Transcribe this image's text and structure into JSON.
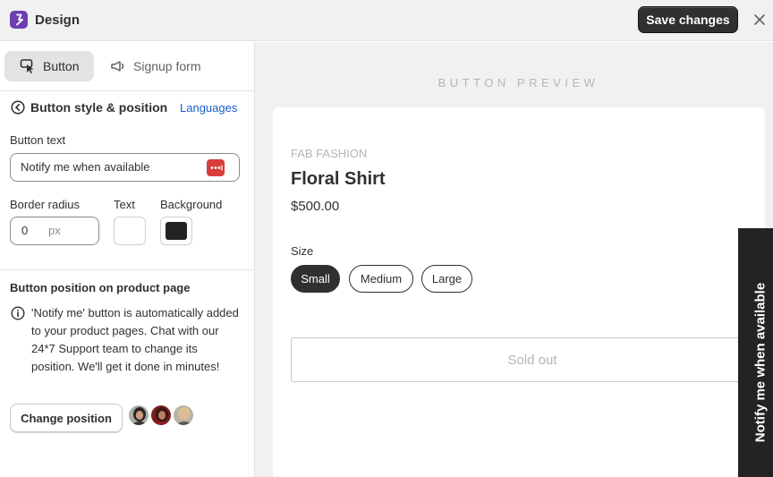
{
  "app": {
    "title": "Design",
    "save_label": "Save changes"
  },
  "tabs": [
    {
      "label": "Button",
      "icon": "cursor-click-icon"
    },
    {
      "label": "Signup form",
      "icon": "megaphone-icon"
    }
  ],
  "section": {
    "title": "Button style & position",
    "languages_link": "Languages"
  },
  "button_text": {
    "label": "Button text",
    "value": "Notify me when available"
  },
  "border_radius": {
    "label": "Border radius",
    "value": "0",
    "unit": "px"
  },
  "text_color": {
    "label": "Text",
    "color": "#ffffff"
  },
  "background_color": {
    "label": "Background",
    "color": "#232323"
  },
  "position": {
    "title": "Button position on product page",
    "info": "'Notify me' button is automatically added to your product pages. Chat with our 24*7 Support team to change its position. We'll get it done in minutes!",
    "change_label": "Change position"
  },
  "preview": {
    "label": "BUTTON PREVIEW",
    "brand": "FAB FASHION",
    "product_name": "Floral Shirt",
    "price": "$500.00",
    "size_label": "Size",
    "sizes": [
      "Small",
      "Medium",
      "Large"
    ],
    "selected_size": "Small",
    "soldout_label": "Sold out",
    "notify_label": "Notify me when available"
  },
  "colors": {
    "accent": "#6d3fb0",
    "link": "#1a5ec7",
    "dark": "#303030"
  }
}
